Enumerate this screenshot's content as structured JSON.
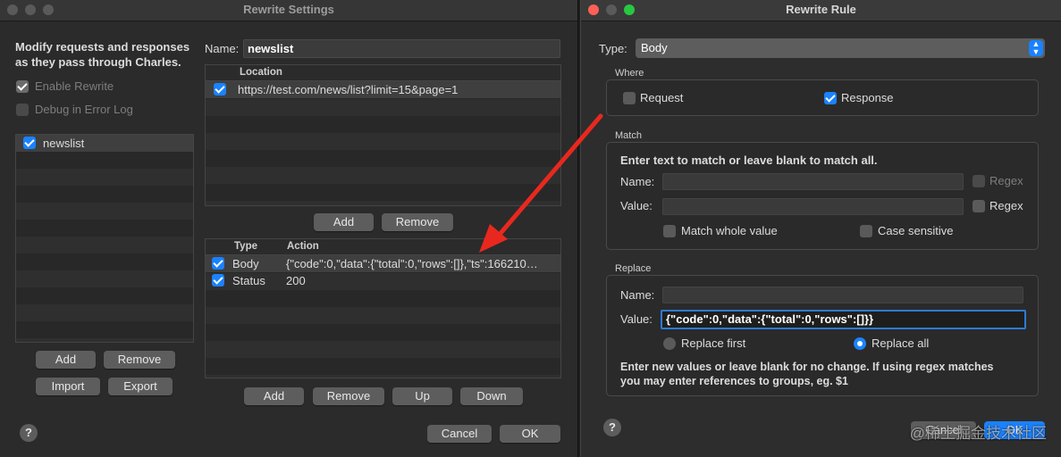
{
  "settings_window": {
    "title": "Rewrite Settings",
    "description_line1": "Modify requests and responses",
    "description_line2": "as they pass through Charles.",
    "enable_rewrite": "Enable Rewrite",
    "debug_in_error_log": "Debug in Error Log",
    "sets": [
      {
        "name": "newslist",
        "checked": true
      }
    ],
    "sets_add": "Add",
    "sets_remove": "Remove",
    "import": "Import",
    "export": "Export",
    "name_label": "Name:",
    "name_value": "newslist",
    "locations_header": "Location",
    "locations": [
      {
        "checked": true,
        "url": "https://test.com/news/list?limit=15&page=1"
      }
    ],
    "locations_add": "Add",
    "locations_remove": "Remove",
    "rules_header_type": "Type",
    "rules_header_action": "Action",
    "rules": [
      {
        "checked": true,
        "type": "Body",
        "action": "{\"code\":0,\"data\":{\"total\":0,\"rows\":[]},\"ts\":166210…"
      },
      {
        "checked": true,
        "type": "Status",
        "action": "200"
      }
    ],
    "rules_add": "Add",
    "rules_remove": "Remove",
    "rules_up": "Up",
    "rules_down": "Down",
    "help": "?",
    "cancel": "Cancel",
    "ok": "OK"
  },
  "rule_window": {
    "title": "Rewrite Rule",
    "type_label": "Type:",
    "type_value": "Body",
    "where_label": "Where",
    "request": "Request",
    "response": "Response",
    "match_label": "Match",
    "match_hint": "Enter text to match or leave blank to match all.",
    "match_name_label": "Name:",
    "match_value_label": "Value:",
    "regex": "Regex",
    "match_whole_value": "Match whole value",
    "case_sensitive": "Case sensitive",
    "replace_label": "Replace",
    "replace_name_label": "Name:",
    "replace_value_label": "Value:",
    "replace_value": "{\"code\":0,\"data\":{\"total\":0,\"rows\":[]}}",
    "replace_first": "Replace first",
    "replace_all": "Replace all",
    "replace_hint_line1": "Enter new values or leave blank for no change. If using regex matches",
    "replace_hint_line2": "you may enter references to groups, eg. $1",
    "help": "?",
    "cancel": "Cancel",
    "ok": "OK"
  },
  "watermark": "@稀土掘金技术社区",
  "colors": {
    "accent": "#1a82ff",
    "annotation_arrow": "#e8281f"
  }
}
